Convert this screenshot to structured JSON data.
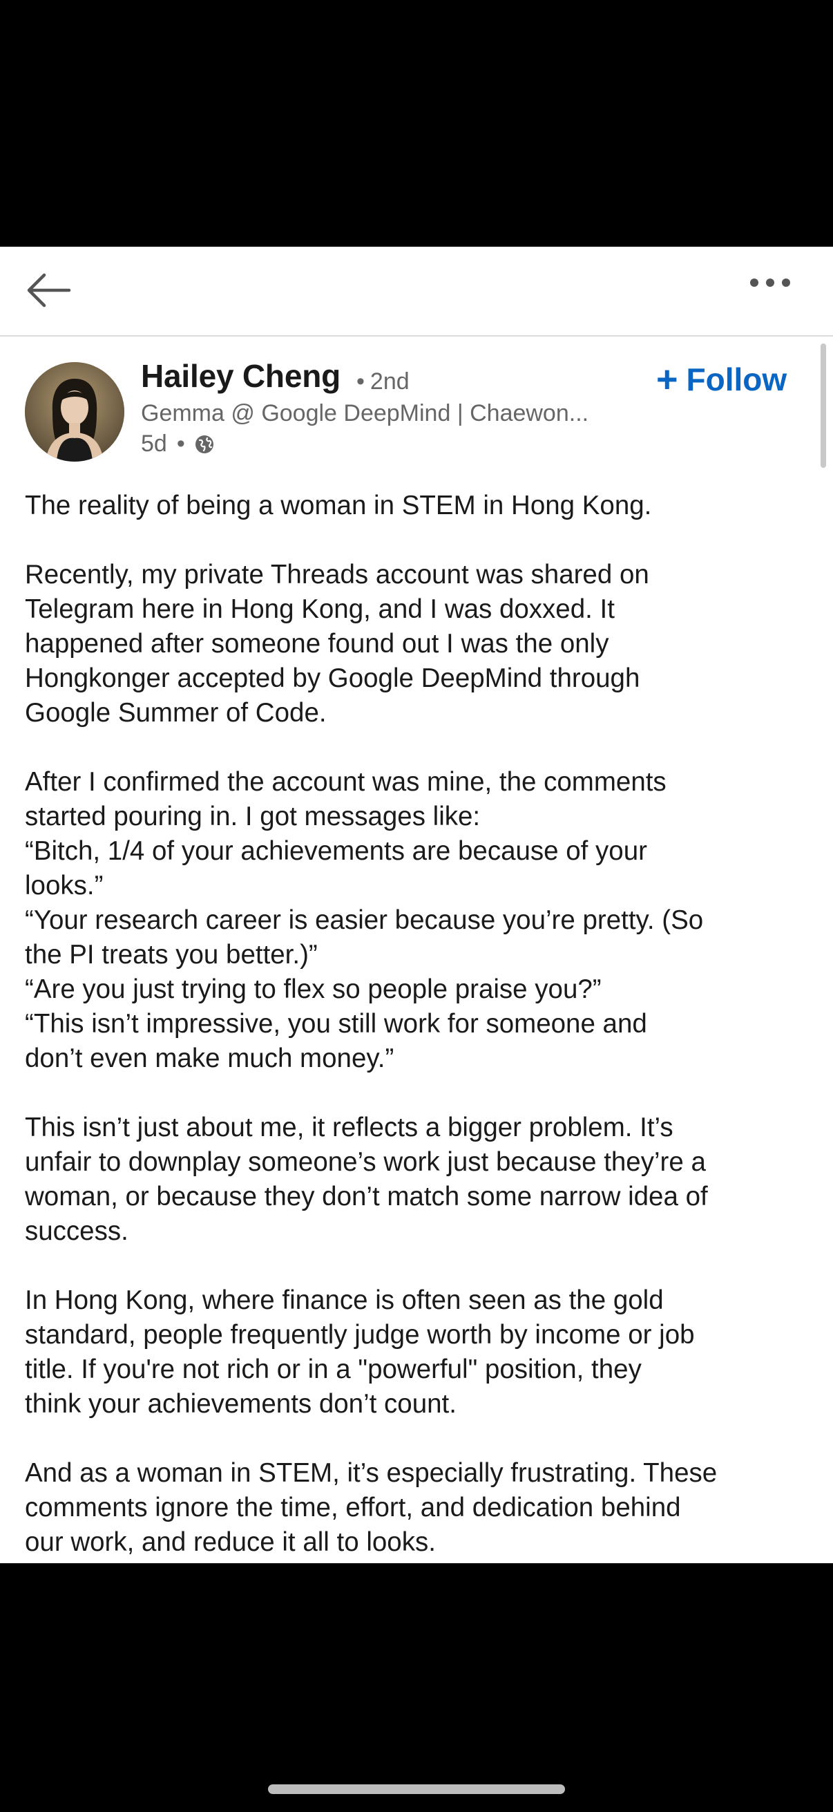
{
  "toolbar": {
    "back_icon": "arrow-left-icon",
    "more_icon": "more-horizontal-icon"
  },
  "post": {
    "author": {
      "name": "Hailey Cheng",
      "degree": "2nd",
      "headline": "Gemma @ Google DeepMind | Chaewon...",
      "time": "5d",
      "visibility_icon": "globe-icon"
    },
    "follow_label": "Follow",
    "paragraphs": [
      [
        "The reality of being a woman in STEM in Hong Kong."
      ],
      [
        "Recently, my private Threads account was shared on",
        "Telegram here in Hong Kong, and I was doxxed. It",
        "happened after someone found out I was the only",
        "Hongkonger accepted by Google DeepMind through",
        "Google Summer of Code."
      ],
      [
        "After I confirmed the account was mine, the comments",
        "started pouring in. I got messages like:",
        "“Bitch, 1/4 of your achievements are because of your",
        "looks.”",
        "“Your research career is easier because you’re pretty. (So",
        "the PI treats you better.)”",
        "“Are you just trying to flex so people praise you?”",
        "“This isn’t impressive, you still work for someone and",
        "don’t even make much money.”"
      ],
      [
        "This isn’t just about me, it reflects a bigger problem. It’s",
        "unfair to downplay someone’s work just because they’re a",
        "woman, or because they don’t match some narrow idea of",
        "success."
      ],
      [
        "In Hong Kong, where finance is often seen as the gold",
        "standard, people frequently judge worth by income or job",
        "title. If you're not rich or in a \"powerful\" position, they",
        "think your achievements don’t count."
      ],
      [
        "And as a woman in STEM, it’s especially frustrating. These",
        "comments ignore the time, effort, and dedication behind",
        "our work, and reduce it all to looks."
      ]
    ]
  },
  "colors": {
    "accent": "#0a66c2",
    "text": "#1a1a1a",
    "muted": "#666666"
  }
}
